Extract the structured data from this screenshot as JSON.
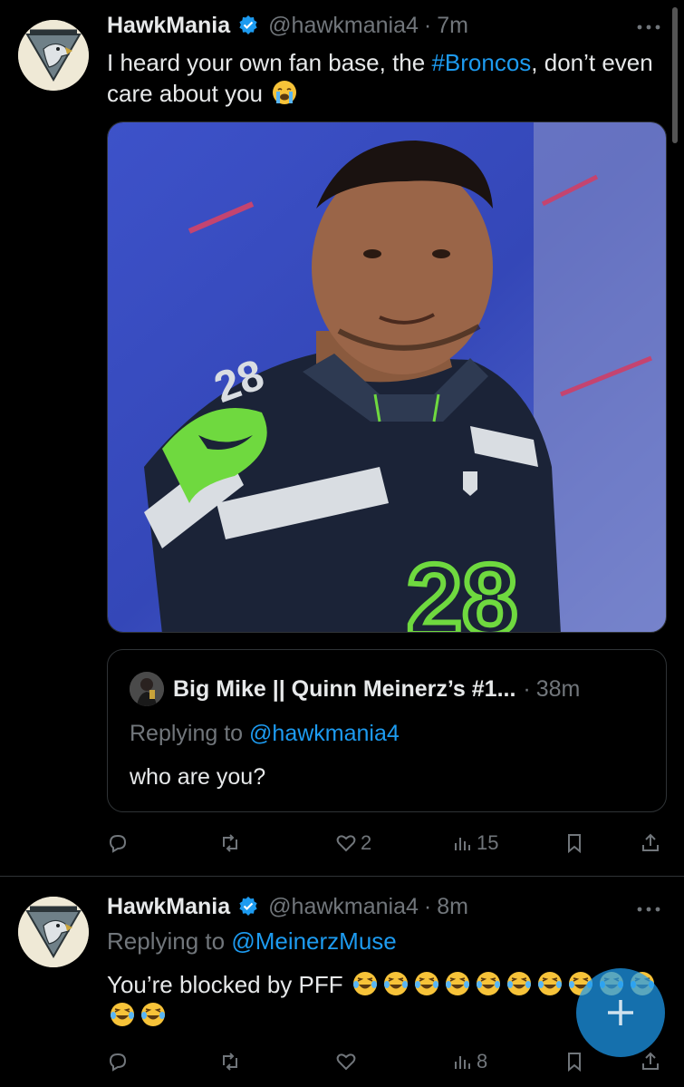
{
  "tweets": [
    {
      "name": "HawkMania",
      "handle": "@hawkmania4",
      "sep": "·",
      "time": "7m",
      "text_before": "I heard your own  fan base, the ",
      "hashtag": "#Broncos",
      "text_after": ", don’t even care about you",
      "emoji": "😭",
      "quote": {
        "name": "Big Mike || Quinn Meinerz’s #1...",
        "sep": "·",
        "time": "38m",
        "replying_label": "Replying to",
        "replying_handle": "@hawkmania4",
        "text": "who are you?"
      },
      "stats": {
        "replies": "",
        "retweets": "",
        "likes": "2",
        "views": "15"
      }
    },
    {
      "name": "HawkMania",
      "handle": "@hawkmania4",
      "sep": "·",
      "time": "8m",
      "replying_label": "Replying to",
      "replying_handle": "@MeinerzMuse",
      "text": "You’re blocked by PFF",
      "emoji": "😂",
      "stats": {
        "replies": "",
        "retweets": "",
        "likes": "",
        "views": "8"
      }
    }
  ],
  "avatar_text": {
    "top": "HawkMania",
    "bottom": "Established 2012"
  },
  "colors": {
    "accent": "#1d9bf0",
    "muted": "#71767b",
    "text": "#e7e9ea",
    "bg": "#000000",
    "border": "#2f3336"
  },
  "icons": [
    "verified-badge-icon",
    "more-icon",
    "reply-icon",
    "retweet-icon",
    "like-icon",
    "views-icon",
    "bookmark-icon",
    "share-icon",
    "compose-plus-icon"
  ]
}
